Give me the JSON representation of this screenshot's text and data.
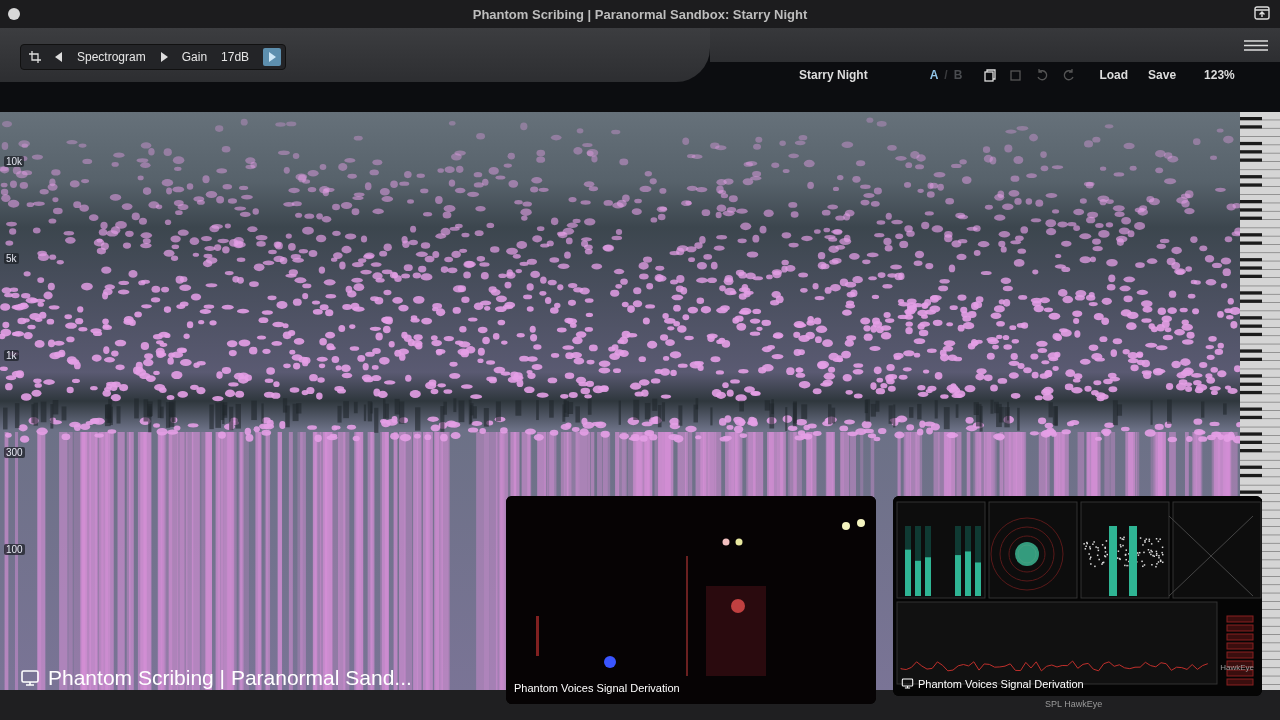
{
  "window": {
    "title": "Phantom Scribing | Paranormal Sandbox: Starry Night"
  },
  "toolbar": {
    "view": "Spectrogram",
    "gain_label": "Gain",
    "gain_value": "17dB",
    "preset": "Starry Night",
    "ab_separator": "/",
    "load": "Load",
    "save": "Save",
    "zoom": "123%",
    "ab": [
      {
        "label": "A",
        "selected": true
      },
      {
        "label": "B",
        "selected": false
      }
    ]
  },
  "spectrogram": {
    "axis_labels": [
      "10k",
      "5k",
      "1k",
      "300",
      "100"
    ]
  },
  "video_tiles": [
    {
      "kind": "camera",
      "caption": "Phantom Voices Signal Derivation"
    },
    {
      "kind": "screen",
      "caption": "Phantom Voices Signal Derivation",
      "brand": "HawkEye",
      "footer": "SPL HawkEye"
    }
  ],
  "screen_share": {
    "caption": "Phantom Scribing | Paranormal Sand..."
  }
}
